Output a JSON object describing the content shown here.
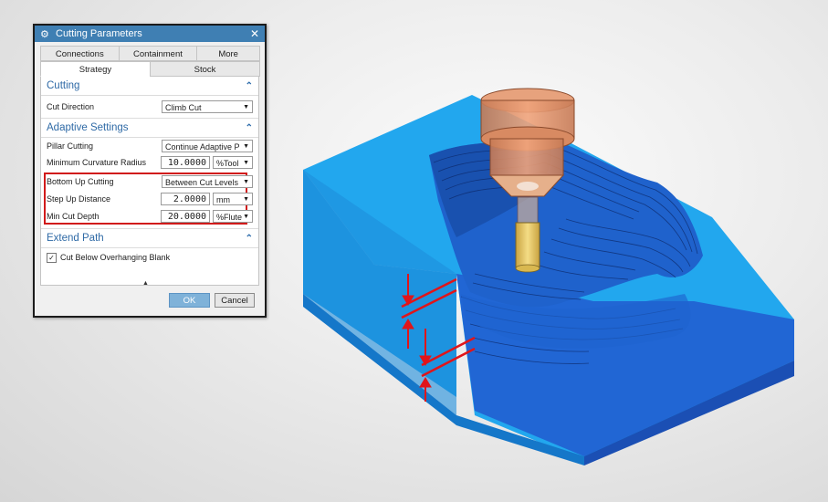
{
  "dialog": {
    "title": "Cutting Parameters",
    "close_icon": "✕",
    "tabs_row1": [
      "Connections",
      "Containment",
      "More"
    ],
    "tabs_row2": [
      "Strategy",
      "Stock"
    ],
    "sections": {
      "cutting": {
        "title": "Cutting",
        "cut_direction_label": "Cut Direction",
        "cut_direction_value": "Climb Cut"
      },
      "adaptive": {
        "title": "Adaptive Settings",
        "pillar_label": "Pillar Cutting",
        "pillar_value": "Continue Adaptive P",
        "min_curv_label": "Minimum Curvature Radius",
        "min_curv_value": "10.0000",
        "min_curv_unit": "%Tool",
        "bottom_up_label": "Bottom Up Cutting",
        "bottom_up_value": "Between Cut Levels",
        "step_up_label": "Step Up Distance",
        "step_up_value": "2.0000",
        "step_up_unit": "mm",
        "min_cut_label": "Min Cut Depth",
        "min_cut_value": "20.0000",
        "min_cut_unit": "%Flute"
      },
      "extend": {
        "title": "Extend Path",
        "cut_below_label": "Cut Below Overhanging Blank",
        "cut_below_checked": true
      }
    },
    "buttons": {
      "ok": "OK",
      "cancel": "Cancel"
    }
  },
  "icons": {
    "gear": "gear-icon",
    "collapse": "chevron-up-icon",
    "dropdown": "chevron-down-icon",
    "checkmark": "check-icon",
    "resize": "resize-grip-icon"
  },
  "colors": {
    "title_bar": "#3f7fb3",
    "section_title": "#2f6aa6",
    "highlight": "#d11a1a",
    "part_top": "#23a3ea",
    "part_side": "#1f73d3",
    "arrow_red": "#e0151a",
    "tool_holder": "#d9875c",
    "tool_shank": "#e8c86b"
  }
}
